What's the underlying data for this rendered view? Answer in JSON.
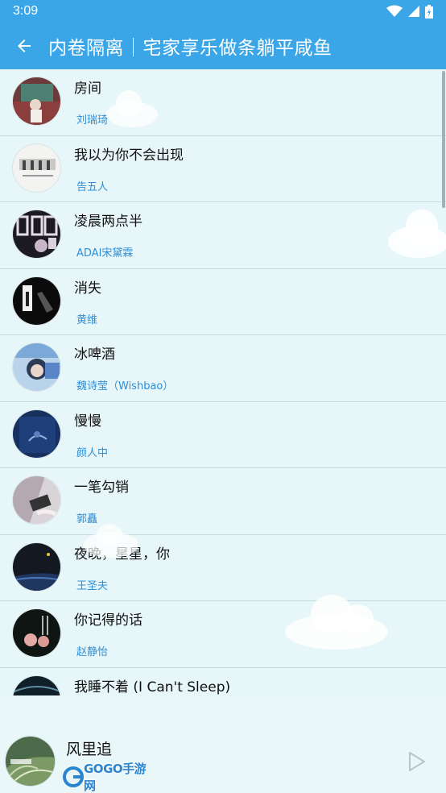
{
  "status_bar": {
    "time": "3:09",
    "icons": [
      "wifi-icon",
      "signal-icon",
      "battery-icon"
    ]
  },
  "app_bar": {
    "title": "内卷隔离｜宅家享乐做条躺平咸鱼",
    "back_icon": "arrow-left-icon"
  },
  "songs": [
    {
      "title": "房间",
      "artist": "刘瑞琦"
    },
    {
      "title": "我以为你不会出现",
      "artist": "告五人"
    },
    {
      "title": "凌晨两点半",
      "artist": "ADAI宋黛霖"
    },
    {
      "title": "消失",
      "artist": "黄维"
    },
    {
      "title": "冰啤酒",
      "artist": "魏诗莹（Wishbao）"
    },
    {
      "title": "慢慢",
      "artist": "颜人中"
    },
    {
      "title": "一笔勾销",
      "artist": "郭矗"
    },
    {
      "title": "夜晚，星星，你",
      "artist": "王圣夫"
    },
    {
      "title": "你记得的话",
      "artist": "赵静怡"
    },
    {
      "title": "我睡不着 (I Can't Sleep)",
      "artist": ""
    }
  ],
  "player": {
    "current_title": "风里追",
    "play_icon": "play-icon"
  },
  "watermark": {
    "text": "GOGO手游网"
  },
  "colors": {
    "accent": "#3aa6e8",
    "artist_text": "#2e8fd8",
    "background": "#e7f6f8"
  }
}
